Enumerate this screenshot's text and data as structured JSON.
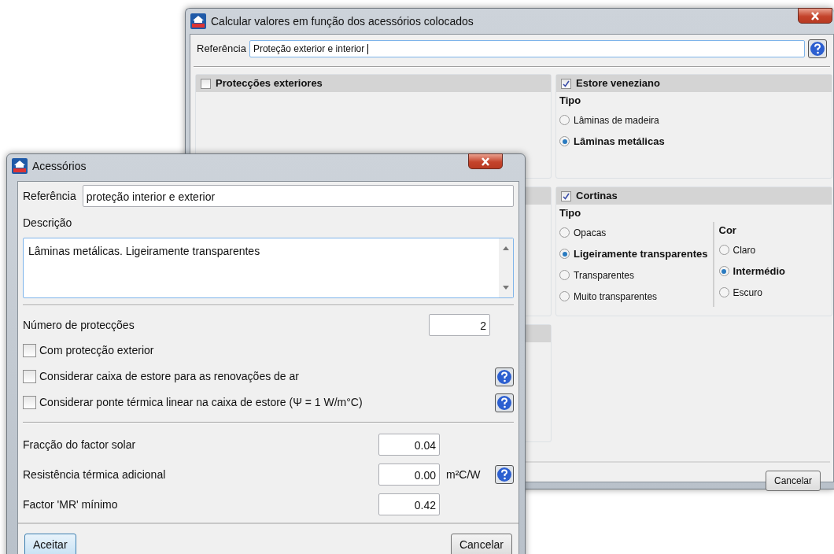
{
  "back_window": {
    "title": "Calcular valores em função dos acessórios colocados",
    "reference_label": "Referência",
    "reference_value": "Proteção exterior e interior",
    "panels": [
      {
        "kind": "options",
        "title": "Protecções exteriores",
        "checked": false
      },
      {
        "kind": "options",
        "title": "Estore veneziano",
        "checked": true,
        "groups": [
          {
            "label": "Tipo",
            "options": [
              {
                "label": "Lâminas de madeira",
                "selected": false
              },
              {
                "label": "Lâminas metálicas",
                "selected": true
              }
            ]
          }
        ]
      },
      {
        "kind": "blank"
      },
      {
        "kind": "options",
        "title": "Cortinas",
        "checked": true,
        "groups": [
          {
            "label": "Tipo",
            "options": [
              {
                "label": "Opacas",
                "selected": false
              },
              {
                "label": "Ligeiramente transparentes",
                "selected": true
              },
              {
                "label": "Transparentes",
                "selected": false
              },
              {
                "label": "Muito transparentes",
                "selected": false
              }
            ]
          },
          {
            "label": "Cor",
            "options": [
              {
                "label": "Claro",
                "selected": false
              },
              {
                "label": "Intermédio",
                "selected": true
              },
              {
                "label": "Escuro",
                "selected": false
              }
            ]
          }
        ]
      },
      {
        "kind": "blank"
      }
    ],
    "cancel_button": "Cancelar"
  },
  "dialog": {
    "title": "Acessórios",
    "reference_label": "Referência",
    "reference_value": "proteção interior e exterior",
    "description_label": "Descrição",
    "description_value": "Lâminas metálicas. Ligeiramente transparentes",
    "count_label": "Número de protecções",
    "count_value": "2",
    "checkboxes": [
      {
        "label": "Com protecção exterior",
        "checked": false,
        "help": false
      },
      {
        "label": "Considerar caixa de estore para as renovações de ar",
        "checked": false,
        "help": true
      },
      {
        "label": "Considerar ponte térmica linear na caixa de estore (Ψ = 1 W/m°C)",
        "checked": false,
        "help": true
      }
    ],
    "values": [
      {
        "label": "Fracção do factor solar",
        "value": "0.04",
        "help": false
      },
      {
        "label": "Resistência térmica adicional",
        "value": "0.00",
        "unit": "m²C/W",
        "help": true
      },
      {
        "label": "Factor 'MR' mínimo",
        "value": "0.42",
        "help": false
      }
    ],
    "ok_button": "Aceitar",
    "cancel_button": "Cancelar"
  }
}
